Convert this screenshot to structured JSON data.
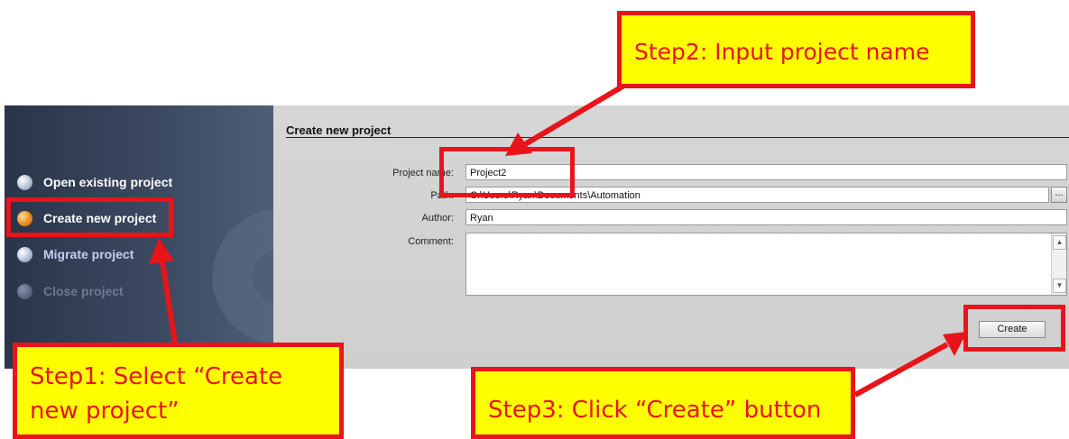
{
  "sidebar": {
    "items": [
      {
        "label": "Open existing project",
        "state": "normal"
      },
      {
        "label": "Create new project",
        "state": "active"
      },
      {
        "label": "Migrate project",
        "state": "normal"
      },
      {
        "label": "Close project",
        "state": "disabled"
      }
    ]
  },
  "main": {
    "title": "Create new project",
    "fields": {
      "project_name": {
        "label": "Project name:",
        "value": "Project2"
      },
      "path": {
        "label": "Path:",
        "value": "C:\\Users\\Ryan\\Documents\\Automation"
      },
      "author": {
        "label": "Author:",
        "value": "Ryan"
      },
      "comment": {
        "label": "Comment:",
        "value": ""
      }
    },
    "browse_label": "...",
    "create_label": "Create"
  },
  "annotations": {
    "step1": "Step1: Select “Create new project”",
    "step2": "Step2: Input project name",
    "step3": "Step3: Click “Create” button"
  },
  "colors": {
    "callout_fill": "#ffff00",
    "callout_border": "#e8141a",
    "sidebar_bg": "#3b4860",
    "active_dot": "#f19a2c"
  }
}
